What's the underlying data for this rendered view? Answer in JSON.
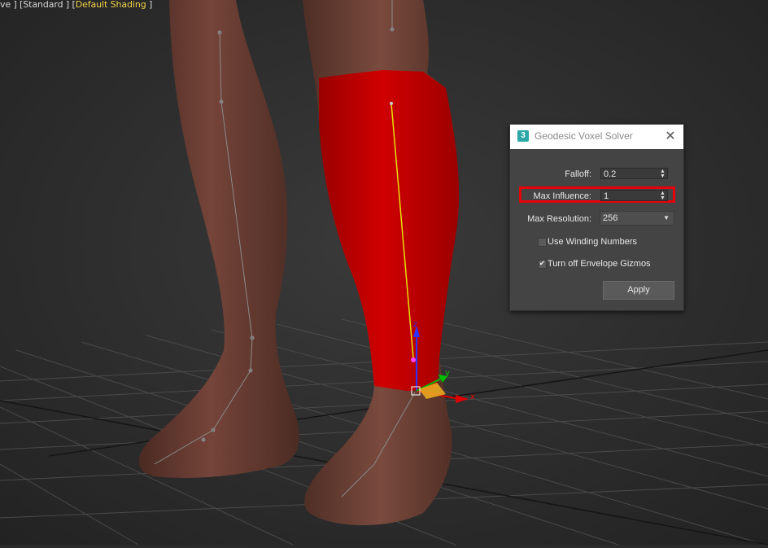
{
  "viewport": {
    "label_prefix": "ve ] [",
    "renderer": "Standard",
    "sep": " ] [",
    "shading": "Default Shading",
    "suffix": " ]"
  },
  "dialog": {
    "icon": "3",
    "title": "Geodesic Voxel Solver",
    "close_icon": "close-icon",
    "falloff_label": "Falloff:",
    "falloff_value": "0.2",
    "max_influence_label": "Max Influence:",
    "max_influence_value": "1",
    "max_resolution_label": "Max Resolution:",
    "max_resolution_value": "256",
    "use_winding_numbers": {
      "label": "Use Winding Numbers",
      "checked": false
    },
    "turn_off_envelope_gizmos": {
      "label": "Turn off Envelope Gizmos",
      "checked": true
    },
    "apply_label": "Apply"
  },
  "gizmo": {
    "x_label": "x",
    "y_label": "y",
    "z_label": "z"
  },
  "colors": {
    "viewport_bg": "#2b2b2b",
    "skin": "#6b3b2e",
    "weight_red": "#c00000",
    "bone_yellow": "#e8e000",
    "highlight_red": "#e8000a"
  }
}
